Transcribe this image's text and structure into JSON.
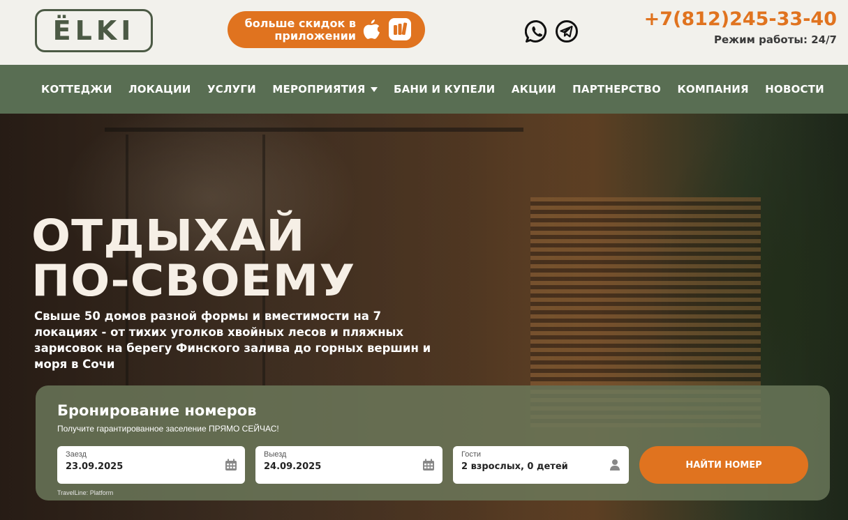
{
  "header": {
    "logo_text": "ЁLKI",
    "app_promo_line1": "больше скидок в",
    "app_promo_line2": "приложении",
    "phone": "+7(812)245-33-40",
    "hours": "Режим работы: 24/7"
  },
  "nav": {
    "items": [
      {
        "label": "КОТТЕДЖИ"
      },
      {
        "label": "ЛОКАЦИИ"
      },
      {
        "label": "УСЛУГИ"
      },
      {
        "label": "МЕРОПРИЯТИЯ"
      },
      {
        "label": "БАНИ И КУПЕЛИ"
      },
      {
        "label": "АКЦИИ"
      },
      {
        "label": "ПАРТНЕРСТВО"
      },
      {
        "label": "КОМПАНИЯ"
      },
      {
        "label": "НОВОСТИ"
      }
    ]
  },
  "hero": {
    "title_line1": "ОТДЫХАЙ",
    "title_line2": "ПО-СВОЕМУ",
    "subtitle": "Свыше 50 домов разной формы и вместимости на 7 локациях - от тихих уголков хвойных лесов и пляжных зарисовок на берегу Финского залива до горных вершин и моря в Сочи"
  },
  "booking": {
    "title": "Бронирование номеров",
    "subtitle": "Получите гарантированное заселение ПРЯМО СЕЙЧАС!",
    "checkin_label": "Заезд",
    "checkin_value": "23.09.2025",
    "checkout_label": "Выезд",
    "checkout_value": "24.09.2025",
    "guests_label": "Гости",
    "guests_value": "2 взрослых, 0 детей",
    "search_label": "НАЙТИ НОМЕР",
    "powered_by": "TravelLine: Platform"
  },
  "colors": {
    "accent": "#e0731f",
    "brand_green": "#4c5a45",
    "nav_bg": "#60765a"
  },
  "icons": [
    "apple-icon",
    "app-store-icon",
    "whatsapp-icon",
    "telegram-icon",
    "calendar-icon",
    "user-icon",
    "chevron-down-icon"
  ]
}
